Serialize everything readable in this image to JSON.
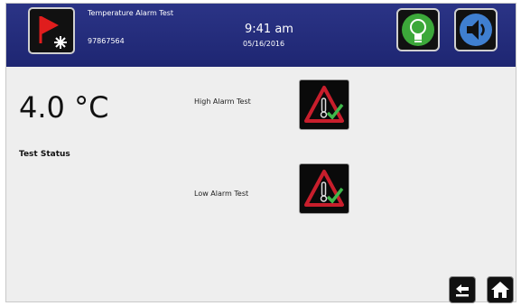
{
  "header": {
    "title": "Temperature Alarm Test",
    "id": "97867564",
    "time": "9:41 am",
    "date": "05/16/2016"
  },
  "main": {
    "temperature": "4.0 °C",
    "status_label": "Test Status",
    "high_alarm_label": "High Alarm Test",
    "low_alarm_label": "Low Alarm Test"
  },
  "icons": {
    "flag": "flag-snowflake-icon",
    "bulb": "lightbulb-icon",
    "sound": "speaker-icon",
    "alarm": "warning-thermometer-check-icon",
    "back": "back-arrow-icon",
    "home": "home-icon"
  },
  "colors": {
    "header_bg": "#232c7a",
    "alarm_red": "#c81e2c",
    "check_green": "#3fb84b",
    "bulb_green": "#3ca83a",
    "sound_blue": "#3f7fd0"
  }
}
